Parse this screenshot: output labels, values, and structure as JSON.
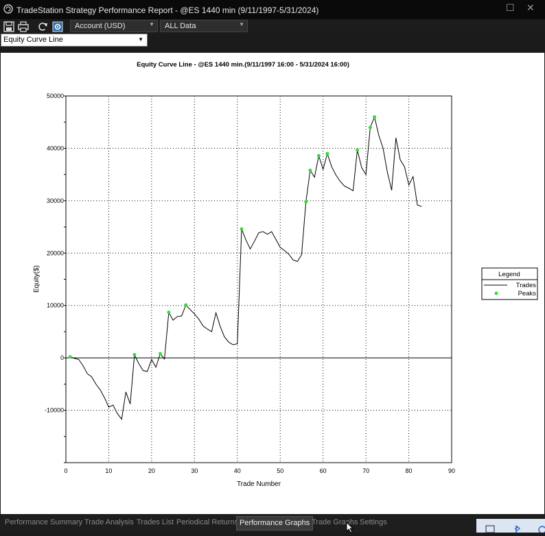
{
  "window": {
    "title": "TradeStation Strategy Performance Report - @ES 1440 min (9/11/1997-5/31/2024)",
    "minimize_glyph": "☐",
    "close_glyph": "✕"
  },
  "toolbar": {
    "account_select": "Account (USD)",
    "data_select": "ALL Data",
    "icons": [
      "save-icon",
      "print-icon",
      "refresh-icon",
      "settings-icon"
    ]
  },
  "graph_selector": {
    "value": "Equity Curve Line"
  },
  "colors": {
    "line": "#000000",
    "peaks": "#33dd33",
    "grid": "#000000",
    "tab_active_bg": "#3a3a3a"
  },
  "chart_data": {
    "type": "line",
    "title": "Equity Curve Line - @ES 1440 min.(9/11/1997 16:00 - 5/31/2024 16:00)",
    "xlabel": "Trade Number",
    "ylabel": "Equity($)",
    "xlim": [
      0,
      90
    ],
    "ylim": [
      -20000,
      50000
    ],
    "xticks": [
      0,
      10,
      20,
      30,
      40,
      50,
      60,
      70,
      80,
      90
    ],
    "yticks": [
      -10000,
      0,
      10000,
      20000,
      30000,
      40000,
      50000
    ],
    "grid": true,
    "legend": {
      "title": "Legend",
      "placement": "right"
    },
    "series": [
      {
        "name": "Trades",
        "style": "line",
        "x": [
          1,
          2,
          3,
          4,
          5,
          6,
          7,
          8,
          9,
          10,
          11,
          12,
          13,
          14,
          15,
          16,
          17,
          18,
          19,
          20,
          21,
          22,
          23,
          24,
          25,
          26,
          27,
          28,
          29,
          30,
          31,
          32,
          33,
          34,
          35,
          36,
          37,
          38,
          39,
          40,
          41,
          42,
          43,
          44,
          45,
          46,
          47,
          48,
          49,
          50,
          51,
          52,
          53,
          54,
          55,
          56,
          57,
          58,
          59,
          60,
          61,
          62,
          63,
          64,
          65,
          66,
          67,
          68,
          69,
          70,
          71,
          72,
          73,
          74,
          75,
          76,
          77,
          78,
          79,
          80,
          81,
          82,
          83
        ],
        "y": [
          200,
          -100,
          -300,
          -1500,
          -3000,
          -3600,
          -5000,
          -6100,
          -7600,
          -9400,
          -9000,
          -10600,
          -11700,
          -6500,
          -8800,
          600,
          -1100,
          -2400,
          -2600,
          -300,
          -1800,
          800,
          -200,
          8700,
          7200,
          7900,
          8000,
          10100,
          9200,
          8400,
          7400,
          6100,
          5500,
          5000,
          8600,
          6000,
          4000,
          3000,
          2500,
          2700,
          24600,
          22500,
          20800,
          22300,
          23900,
          24100,
          23600,
          24100,
          22600,
          21100,
          20500,
          19800,
          18700,
          18400,
          19700,
          29800,
          35800,
          34500,
          38600,
          36000,
          39000,
          36500,
          34900,
          33700,
          32800,
          32400,
          31900,
          39700,
          36300,
          35000,
          44000,
          46000,
          42500,
          40000,
          35500,
          32000,
          42000,
          37800,
          36500,
          33000,
          34600,
          29200,
          28900
        ]
      },
      {
        "name": "Peaks",
        "style": "points",
        "x": [
          1,
          16,
          22,
          24,
          28,
          41,
          56,
          57,
          59,
          61,
          68,
          71,
          72
        ],
        "y": [
          200,
          600,
          800,
          8700,
          10100,
          24600,
          29800,
          35800,
          38600,
          39000,
          39700,
          44000,
          46000
        ]
      }
    ]
  },
  "bottom_tabs": [
    {
      "label": "Performance Summary",
      "active": false
    },
    {
      "label": "Trade Analysis",
      "active": false
    },
    {
      "label": "Trades List",
      "active": false
    },
    {
      "label": "Periodical Returns",
      "active": false
    },
    {
      "label": "Performance Graphs",
      "active": true
    },
    {
      "label": "Trade Graphs",
      "active": false
    },
    {
      "label": "Settings",
      "active": false
    }
  ]
}
